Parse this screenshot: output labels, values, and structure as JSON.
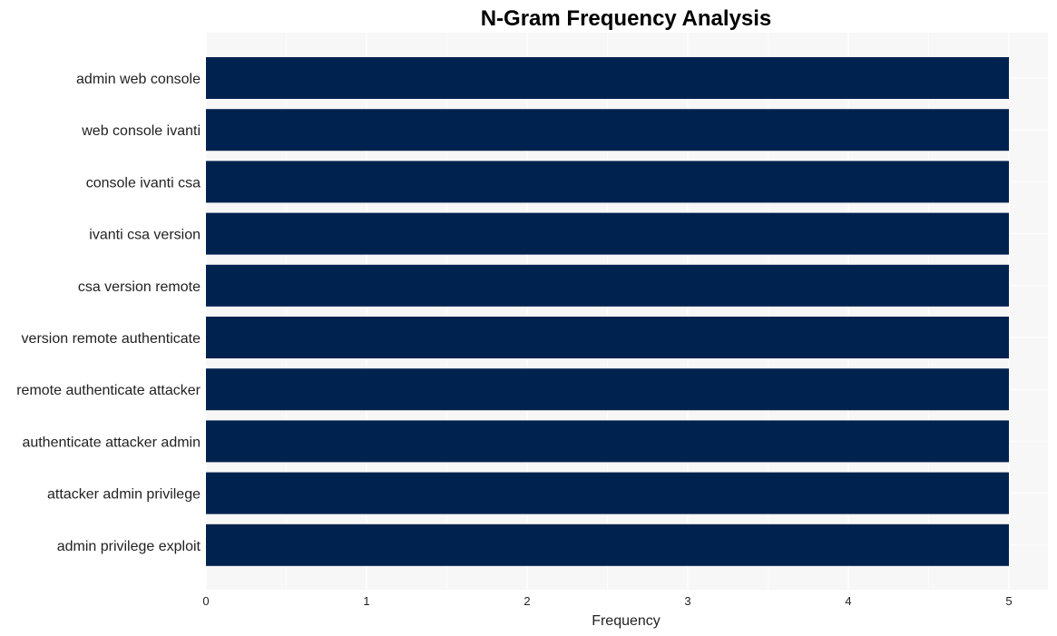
{
  "chart_data": {
    "type": "bar",
    "orientation": "horizontal",
    "title": "N-Gram Frequency Analysis",
    "xlabel": "Frequency",
    "ylabel": "",
    "xlim": [
      0,
      5.25
    ],
    "xticks": [
      0,
      1,
      2,
      3,
      4,
      5
    ],
    "grid": true,
    "legend": "none",
    "bar_color": "#00224e",
    "background_color": "#f7f7f7",
    "categories": [
      "admin web console",
      "web console ivanti",
      "console ivanti csa",
      "ivanti csa version",
      "csa version remote",
      "version remote authenticate",
      "remote authenticate attacker",
      "authenticate attacker admin",
      "attacker admin privilege",
      "admin privilege exploit"
    ],
    "values": [
      5,
      5,
      5,
      5,
      5,
      5,
      5,
      5,
      5,
      5
    ]
  }
}
